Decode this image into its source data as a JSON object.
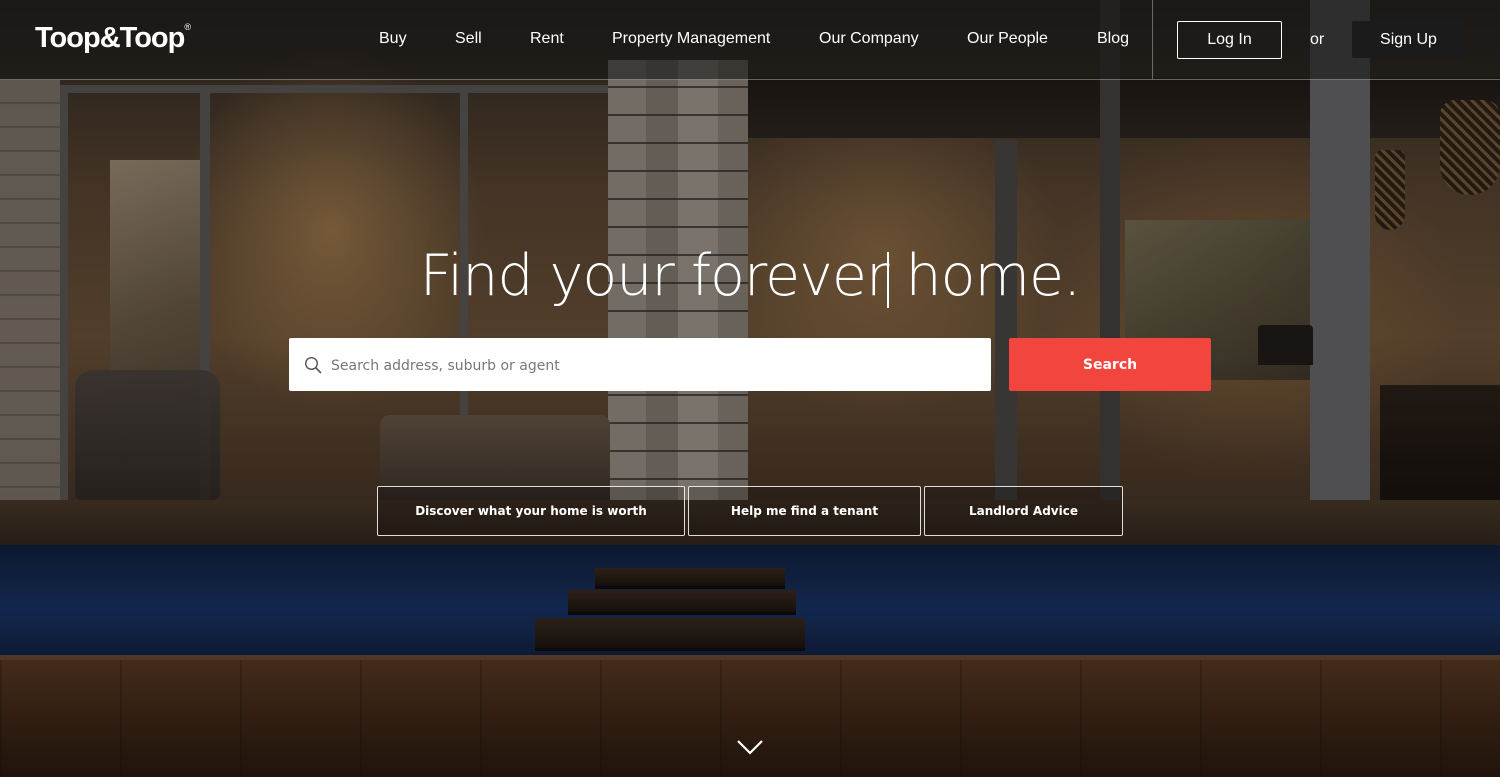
{
  "header": {
    "logo": "Toop&Toop",
    "logo_mark": "®",
    "nav": [
      "Buy",
      "Sell",
      "Rent",
      "Property Management",
      "Our Company",
      "Our People",
      "Blog"
    ],
    "login_label": "Log In",
    "or_label": "or",
    "signup_label": "Sign Up"
  },
  "hero": {
    "title": "Find your forever home.",
    "search_placeholder": "Search address, suburb or agent",
    "search_button": "Search",
    "quick_links": [
      "Discover what your home is worth",
      "Help me find a tenant",
      "Landlord Advice"
    ]
  },
  "colors": {
    "accent": "#f2453d",
    "signup_bg": "#1b1b1b"
  },
  "icons": {
    "search": "search-icon",
    "scroll": "chevron-down-icon"
  }
}
